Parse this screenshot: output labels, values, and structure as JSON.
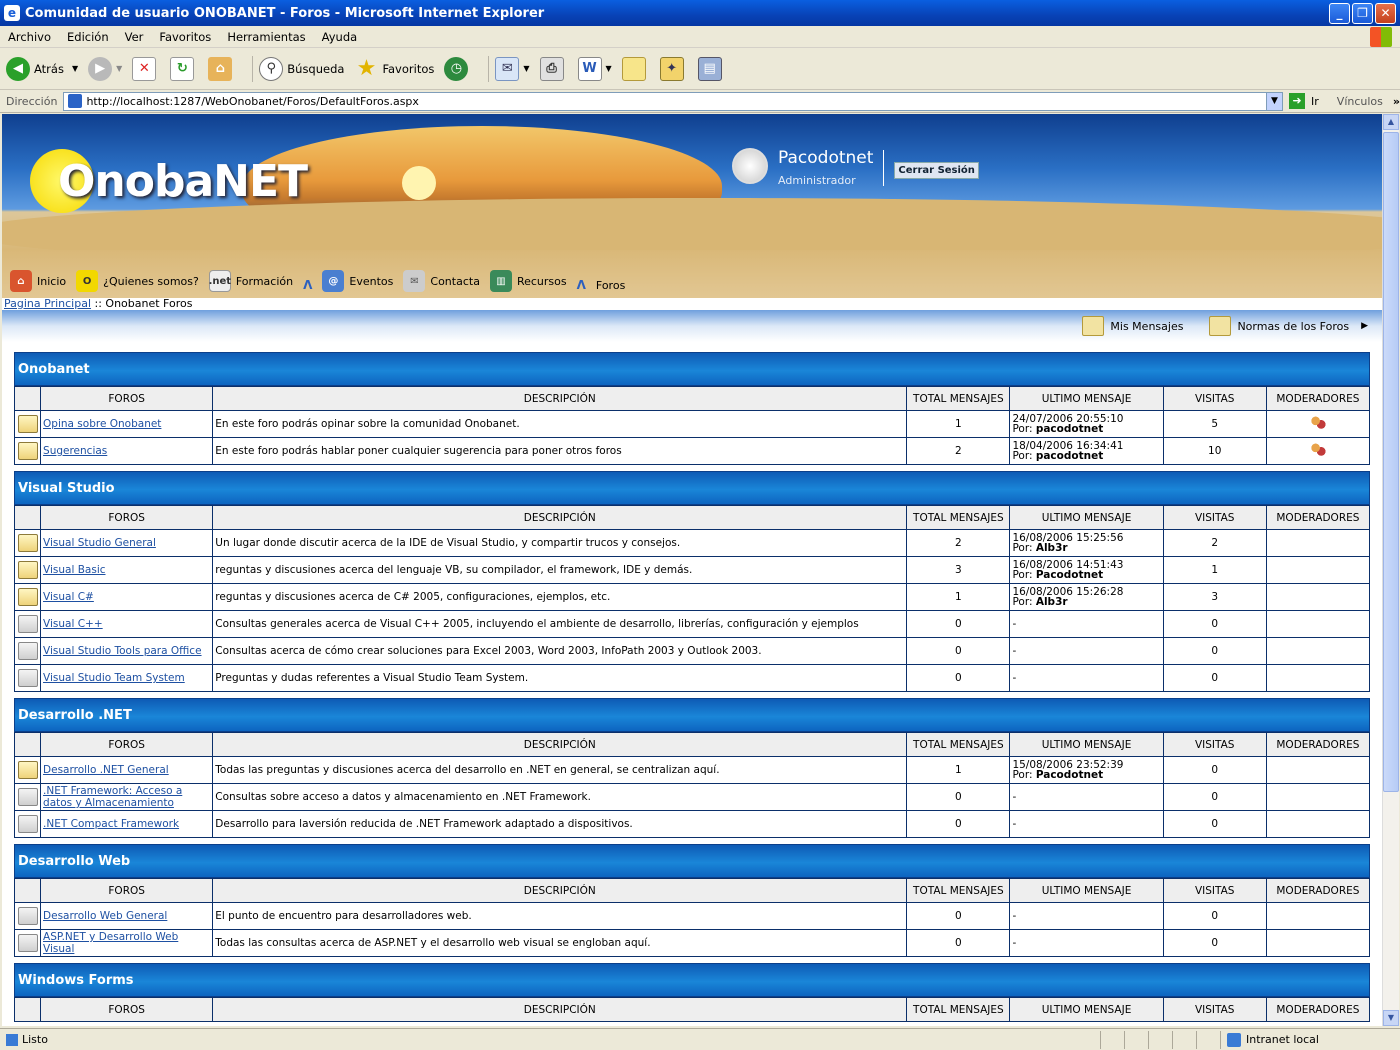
{
  "window": {
    "title": "Comunidad de usuario ONOBANET - Foros - Microsoft Internet Explorer"
  },
  "menu": [
    "Archivo",
    "Edición",
    "Ver",
    "Favoritos",
    "Herramientas",
    "Ayuda"
  ],
  "toolbar": {
    "back": "Atrás",
    "search": "Búsqueda",
    "favorites": "Favoritos"
  },
  "address": {
    "label": "Dirección",
    "url": "http://localhost:1287/WebOnobanet/Foros/DefaultForos.aspx",
    "go": "Ir",
    "links": "Vínculos"
  },
  "header": {
    "logo": "OnobaNET",
    "user": "Pacodotnet",
    "role": "Administrador",
    "logout": "Cerrar Sesión"
  },
  "nav": [
    "Inicio",
    "¿Quienes somos?",
    "Formación",
    "Eventos",
    "Contacta",
    "Recursos",
    "Foros"
  ],
  "breadcrumb": {
    "home": "Pagina Principal",
    "sep": " :: ",
    "current": "Onobanet Foros"
  },
  "actions": {
    "messages": "Mis Mensajes",
    "rules": "Normas de los Foros"
  },
  "columns": [
    "FOROS",
    "DESCRIPCIÓN",
    "TOTAL MENSAJES",
    "ULTIMO MENSAJE",
    "VISITAS",
    "MODERADORES"
  ],
  "sections": [
    {
      "title": "Onobanet",
      "rows": [
        {
          "name": "Opina sobre Onobanet",
          "desc": "En este foro podrás opinar sobre la comunidad Onobanet.",
          "total": "1",
          "date": "24/07/2006 20:55:10",
          "by": "pacodotnet",
          "visits": "5",
          "mod": true,
          "active": true
        },
        {
          "name": "Sugerencias",
          "desc": "En este foro podrás hablar poner cualquier sugerencia para poner otros foros",
          "total": "2",
          "date": "18/04/2006 16:34:41",
          "by": "pacodotnet",
          "visits": "10",
          "mod": true,
          "active": true
        }
      ]
    },
    {
      "title": "Visual Studio",
      "rows": [
        {
          "name": "Visual Studio General",
          "desc": "Un lugar donde discutir acerca de la IDE de Visual Studio, y compartir trucos y consejos.",
          "total": "2",
          "date": "16/08/2006 15:25:56",
          "by": "Alb3r",
          "visits": "2",
          "mod": false,
          "active": true
        },
        {
          "name": "Visual Basic",
          "desc": "reguntas y discusiones acerca del lenguaje VB, su compilador, el framework, IDE y demás.",
          "total": "3",
          "date": "16/08/2006 14:51:43",
          "by": "Pacodotnet",
          "visits": "1",
          "mod": false,
          "active": true
        },
        {
          "name": "Visual C#",
          "desc": "reguntas y discusiones acerca de C# 2005, configuraciones, ejemplos, etc.",
          "total": "1",
          "date": "16/08/2006 15:26:28",
          "by": "Alb3r",
          "visits": "3",
          "mod": false,
          "active": true
        },
        {
          "name": "Visual C++",
          "desc": "Consultas generales acerca de Visual C++ 2005, incluyendo el ambiente de desarrollo, librerías, configuración y ejemplos",
          "total": "0",
          "date": "-",
          "by": "",
          "visits": "0",
          "mod": false,
          "active": false
        },
        {
          "name": "Visual Studio Tools para Office",
          "desc": "Consultas acerca de cómo crear soluciones para Excel 2003, Word 2003, InfoPath 2003 y Outlook 2003.",
          "total": "0",
          "date": "-",
          "by": "",
          "visits": "0",
          "mod": false,
          "active": false
        },
        {
          "name": "Visual Studio Team System",
          "desc": "Preguntas y dudas referentes a Visual Studio Team System.",
          "total": "0",
          "date": "-",
          "by": "",
          "visits": "0",
          "mod": false,
          "active": false
        }
      ]
    },
    {
      "title": "Desarrollo .NET",
      "rows": [
        {
          "name": "Desarrollo .NET General",
          "desc": "Todas las preguntas y discusiones acerca del desarrollo en .NET en general, se centralizan aquí.",
          "total": "1",
          "date": "15/08/2006 23:52:39",
          "by": "Pacodotnet",
          "visits": "0",
          "mod": false,
          "active": true
        },
        {
          "name": ".NET Framework: Acceso a datos y Almacenamiento",
          "desc": "Consultas sobre acceso a datos y almacenamiento en .NET Framework.",
          "total": "0",
          "date": "-",
          "by": "",
          "visits": "0",
          "mod": false,
          "active": false
        },
        {
          "name": ".NET Compact Framework",
          "desc": "Desarrollo para laversión reducida de .NET Framework adaptado a dispositivos.",
          "total": "0",
          "date": "-",
          "by": "",
          "visits": "0",
          "mod": false,
          "active": false
        }
      ]
    },
    {
      "title": "Desarrollo Web",
      "rows": [
        {
          "name": "Desarrollo Web General",
          "desc": "El punto de encuentro para desarrolladores web.",
          "total": "0",
          "date": "-",
          "by": "",
          "visits": "0",
          "mod": false,
          "active": false
        },
        {
          "name": "ASP.NET y Desarrollo Web Visual",
          "desc": "Todas las consultas acerca de ASP.NET y el desarrollo web visual se engloban aquí.",
          "total": "0",
          "date": "-",
          "by": "",
          "visits": "0",
          "mod": false,
          "active": false
        }
      ]
    },
    {
      "title": "Windows Forms",
      "rows": []
    }
  ],
  "status": {
    "left": "Listo",
    "zone": "Intranet local"
  }
}
